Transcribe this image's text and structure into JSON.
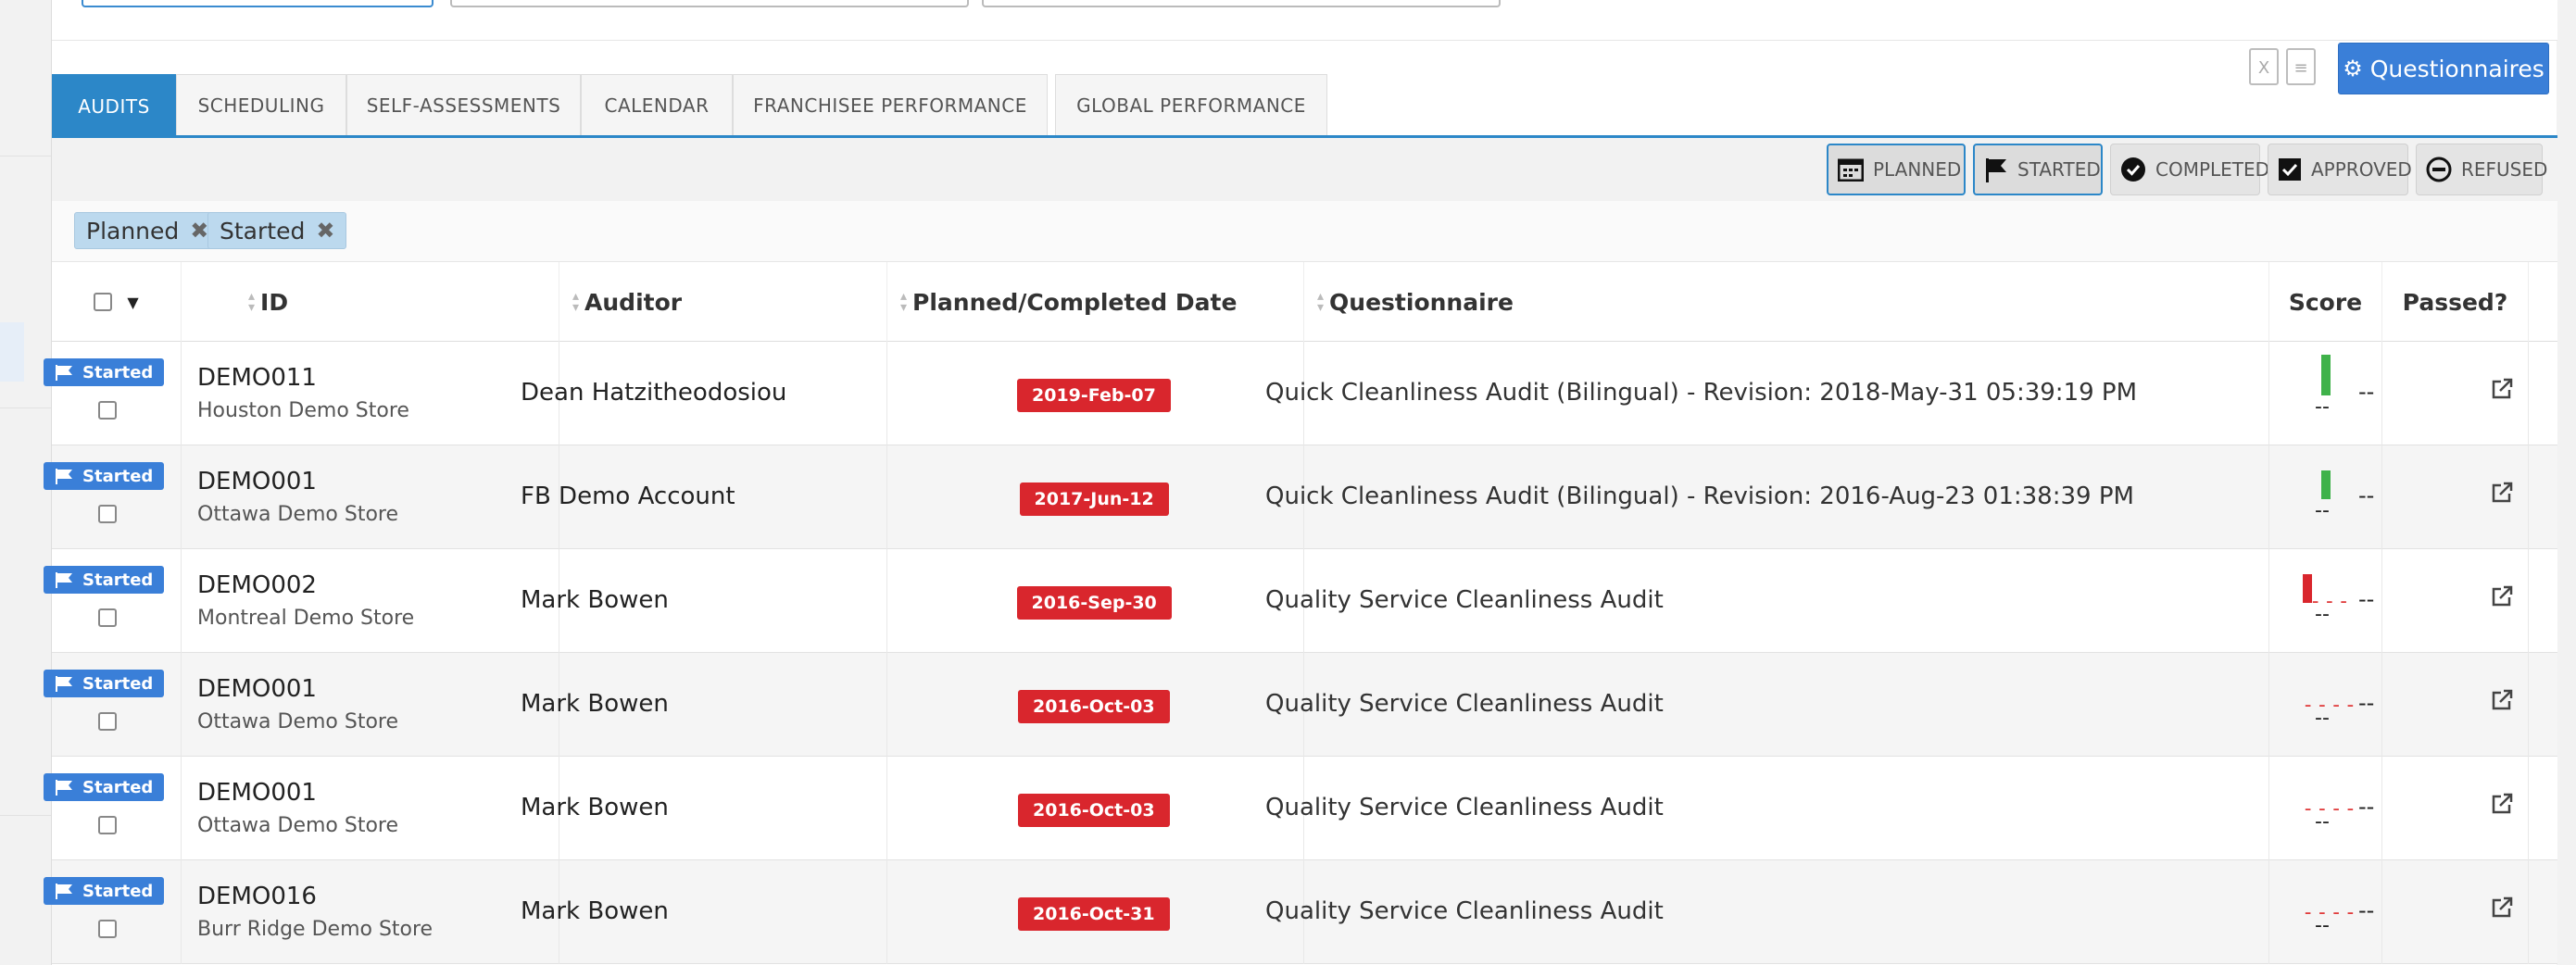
{
  "toolbar": {
    "excel_icon": "excel-icon",
    "doc_icon": "document-icon",
    "questionnaires_label": "Questionnaires"
  },
  "tabs": [
    {
      "label": "AUDITS",
      "active": true
    },
    {
      "label": "SCHEDULING",
      "active": false
    },
    {
      "label": "SELF-ASSESSMENTS",
      "active": false
    },
    {
      "label": "CALENDAR",
      "active": false
    },
    {
      "label": "FRANCHISEE PERFORMANCE",
      "active": false
    },
    {
      "label": "GLOBAL PERFORMANCE",
      "active": false
    }
  ],
  "status_filters": [
    {
      "label": "PLANNED",
      "selected": true,
      "icon": "calendar-grid-icon"
    },
    {
      "label": "STARTED",
      "selected": true,
      "icon": "flag-icon"
    },
    {
      "label": "COMPLETED",
      "selected": false,
      "icon": "check-circle-icon"
    },
    {
      "label": "APPROVED",
      "selected": false,
      "icon": "check-square-icon"
    },
    {
      "label": "REFUSED",
      "selected": false,
      "icon": "minus-circle-icon"
    }
  ],
  "active_chips": [
    {
      "label": "Planned"
    },
    {
      "label": "Started"
    }
  ],
  "table": {
    "columns": {
      "id": "ID",
      "auditor": "Auditor",
      "date": "Planned/Completed Date",
      "questionnaire": "Questionnaire",
      "score": "Score",
      "passed": "Passed?"
    },
    "rows": [
      {
        "status": "Started",
        "id": "DEMO011",
        "store": "Houston Demo Store",
        "auditor": "Dean Hatzitheodosiou",
        "date": "2019-Feb-07",
        "questionnaire": "Quick Cleanliness Audit (Bilingual) - Revision: 2018-May-31 05:39:19 PM",
        "score_bar": "green",
        "score_bar_level": 1.0,
        "score": "--",
        "passed": "--"
      },
      {
        "status": "Started",
        "id": "DEMO001",
        "store": "Ottawa Demo Store",
        "auditor": "FB Demo Account",
        "date": "2017-Jun-12",
        "questionnaire": "Quick Cleanliness Audit (Bilingual) - Revision: 2016-Aug-23 01:38:39 PM",
        "score_bar": "green",
        "score_bar_level": 0.7,
        "score": "--",
        "passed": "--"
      },
      {
        "status": "Started",
        "id": "DEMO002",
        "store": "Montreal Demo Store",
        "auditor": "Mark Bowen",
        "date": "2016-Sep-30",
        "questionnaire": "Quality Service Cleanliness Audit",
        "score_bar": "red",
        "score_bar_level": 0.7,
        "score": "--",
        "passed": "--"
      },
      {
        "status": "Started",
        "id": "DEMO001",
        "store": "Ottawa Demo Store",
        "auditor": "Mark Bowen",
        "date": "2016-Oct-03",
        "questionnaire": "Quality Service Cleanliness Audit",
        "score_bar": "none",
        "score_bar_level": 0,
        "score": "--",
        "passed": "--"
      },
      {
        "status": "Started",
        "id": "DEMO001",
        "store": "Ottawa Demo Store",
        "auditor": "Mark Bowen",
        "date": "2016-Oct-03",
        "questionnaire": "Quality Service Cleanliness Audit",
        "score_bar": "none",
        "score_bar_level": 0,
        "score": "--",
        "passed": "--"
      },
      {
        "status": "Started",
        "id": "DEMO016",
        "store": "Burr Ridge Demo Store",
        "auditor": "Mark Bowen",
        "date": "2016-Oct-31",
        "questionnaire": "Quality Service Cleanliness Audit",
        "score_bar": "none",
        "score_bar_level": 0,
        "score": "--",
        "passed": "--"
      }
    ]
  },
  "colors": {
    "accent": "#2c87c8",
    "primary_button": "#3a7fd8",
    "date_badge": "#d9262d",
    "score_green": "#3fb24a",
    "score_red": "#d9262d"
  }
}
